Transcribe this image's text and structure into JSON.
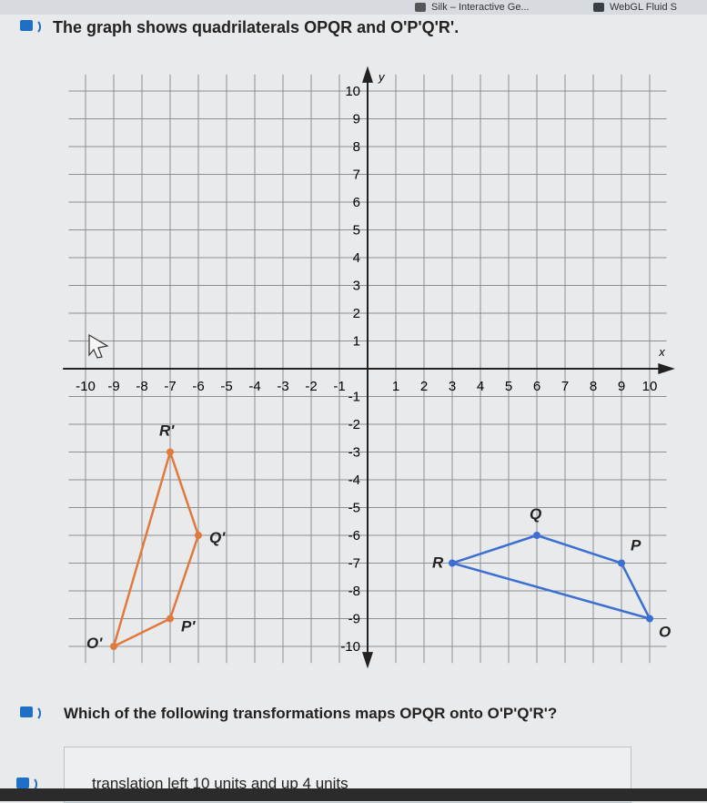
{
  "tabs": [
    {
      "label": "Silk – Interactive Ge..."
    },
    {
      "label": "WebGL Fluid S"
    }
  ],
  "prompt": {
    "text": "The graph shows quadrilaterals OPQR and O'P'Q'R'."
  },
  "question": {
    "text": "Which of the following transformations maps OPQR onto O'P'Q'R'?"
  },
  "choices": [
    {
      "label": "translation left 10 units and up 4 units"
    }
  ],
  "colors": {
    "grid": "#8b8f94",
    "axis": "#222222",
    "OPQR": "#3b6fd1",
    "image": "#e07a3c",
    "accent": "#1f6fc6"
  },
  "icons": [
    "speaker-icon",
    "mouse-cursor-icon"
  ],
  "graph": {
    "x_label": "x",
    "y_label": "y",
    "x_range": [
      -10,
      10
    ],
    "y_range": [
      -10,
      10
    ],
    "x_ticks": [
      "-10",
      "-9",
      "-8",
      "-7",
      "-6",
      "-5",
      "-4",
      "-3",
      "-2",
      "-1",
      "1",
      "2",
      "3",
      "4",
      "5",
      "6",
      "7",
      "8",
      "9",
      "10"
    ],
    "y_ticks": [
      "10",
      "9",
      "8",
      "7",
      "6",
      "5",
      "4",
      "3",
      "2",
      "1",
      "-1",
      "-2",
      "-3",
      "-4",
      "-5",
      "-6",
      "-7",
      "-8",
      "-9",
      "-10"
    ],
    "shapes": [
      {
        "name": "OPQR",
        "points": [
          {
            "label": "O",
            "x": 10,
            "y": -9
          },
          {
            "label": "P",
            "x": 9,
            "y": -7
          },
          {
            "label": "Q",
            "x": 6,
            "y": -6
          },
          {
            "label": "R",
            "x": 3,
            "y": -7
          }
        ]
      },
      {
        "name": "O'P'Q'R'",
        "points": [
          {
            "label": "O'",
            "x": -9,
            "y": -10
          },
          {
            "label": "P'",
            "x": -7,
            "y": -9
          },
          {
            "label": "Q'",
            "x": -6,
            "y": -6
          },
          {
            "label": "R'",
            "x": -7,
            "y": -3
          }
        ]
      }
    ]
  }
}
